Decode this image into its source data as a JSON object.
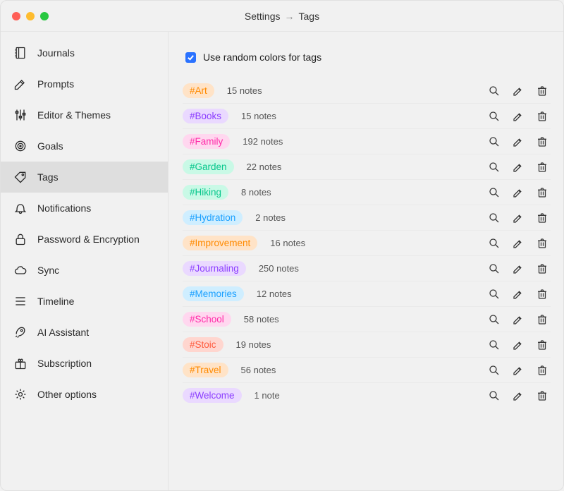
{
  "title": {
    "left": "Settings",
    "arrow": "→",
    "right": "Tags"
  },
  "sidebar": {
    "items": [
      {
        "label": "Journals",
        "icon": "journals"
      },
      {
        "label": "Prompts",
        "icon": "pencil"
      },
      {
        "label": "Editor & Themes",
        "icon": "sliders"
      },
      {
        "label": "Goals",
        "icon": "target"
      },
      {
        "label": "Tags",
        "icon": "tag",
        "active": true
      },
      {
        "label": "Notifications",
        "icon": "bell"
      },
      {
        "label": "Password & Encryption",
        "icon": "lock"
      },
      {
        "label": "Sync",
        "icon": "cloud"
      },
      {
        "label": "Timeline",
        "icon": "timeline"
      },
      {
        "label": "AI Assistant",
        "icon": "rocket"
      },
      {
        "label": "Subscription",
        "icon": "gift"
      },
      {
        "label": "Other options",
        "icon": "gear"
      }
    ]
  },
  "option": {
    "use_random_colors_label": "Use random colors for tags",
    "checked": true
  },
  "tags": [
    {
      "label": "#Art",
      "count_text": "15 notes",
      "bg": "#ffe3c7",
      "fg": "#ff8a00"
    },
    {
      "label": "#Books",
      "count_text": "15 notes",
      "bg": "#ead9ff",
      "fg": "#8b3dff"
    },
    {
      "label": "#Family",
      "count_text": "192 notes",
      "bg": "#ffd7ef",
      "fg": "#ff2aa8"
    },
    {
      "label": "#Garden",
      "count_text": "22 notes",
      "bg": "#c9f9e6",
      "fg": "#06c78b"
    },
    {
      "label": "#Hiking",
      "count_text": "8 notes",
      "bg": "#c9f9e6",
      "fg": "#06c78b"
    },
    {
      "label": "#Hydration",
      "count_text": "2 notes",
      "bg": "#cfeeff",
      "fg": "#1aa0ff"
    },
    {
      "label": "#Improvement",
      "count_text": "16 notes",
      "bg": "#ffe3c7",
      "fg": "#ff8a00"
    },
    {
      "label": "#Journaling",
      "count_text": "250 notes",
      "bg": "#ead9ff",
      "fg": "#8b3dff"
    },
    {
      "label": "#Memories",
      "count_text": "12 notes",
      "bg": "#cfeeff",
      "fg": "#1aa0ff"
    },
    {
      "label": "#School",
      "count_text": "58 notes",
      "bg": "#ffd7ef",
      "fg": "#ff2aa8"
    },
    {
      "label": "#Stoic",
      "count_text": "19 notes",
      "bg": "#ffd6cf",
      "fg": "#ff5a3d"
    },
    {
      "label": "#Travel",
      "count_text": "56 notes",
      "bg": "#ffe3c7",
      "fg": "#ff8a00"
    },
    {
      "label": "#Welcome",
      "count_text": "1 note",
      "bg": "#ead9ff",
      "fg": "#8b3dff"
    }
  ]
}
